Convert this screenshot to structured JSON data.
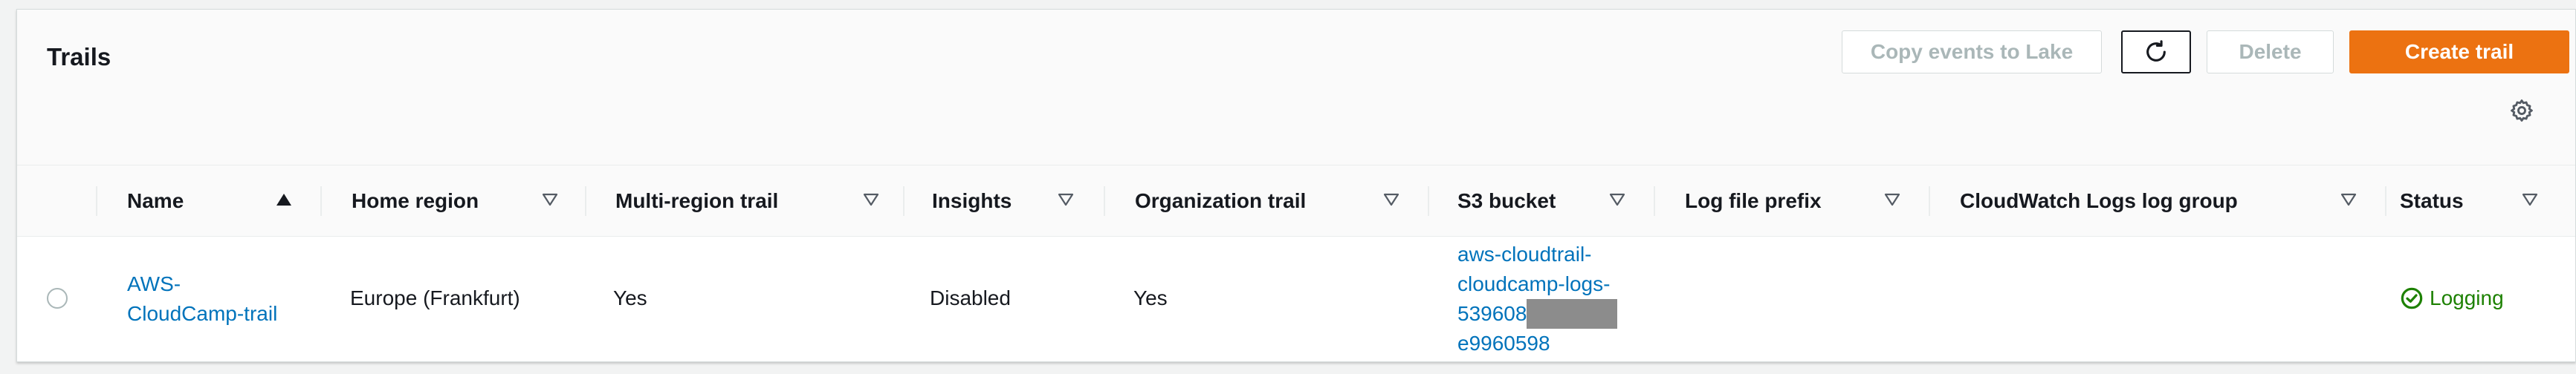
{
  "header": {
    "title": "Trails",
    "buttons": {
      "copy_events": "Copy events to Lake",
      "delete": "Delete",
      "create": "Create trail"
    }
  },
  "table": {
    "columns": [
      {
        "label": "Name",
        "sort": "ascending"
      },
      {
        "label": "Home region",
        "sort": "none"
      },
      {
        "label": "Multi-region trail",
        "sort": "none"
      },
      {
        "label": "Insights",
        "sort": "none"
      },
      {
        "label": "Organization trail",
        "sort": "none"
      },
      {
        "label": "S3 bucket",
        "sort": "none"
      },
      {
        "label": "Log file prefix",
        "sort": "none"
      },
      {
        "label": "CloudWatch Logs log group",
        "sort": "none"
      },
      {
        "label": "Status",
        "sort": "none"
      }
    ],
    "rows": [
      {
        "name": "AWS-CloudCamp-trail",
        "name_lines": [
          "AWS-",
          "CloudCamp-trail"
        ],
        "home_region": "Europe (Frankfurt)",
        "multi_region": "Yes",
        "insights": "Disabled",
        "organization": "Yes",
        "s3_bucket_lines": [
          "aws-cloudtrail-",
          "cloudcamp-logs-",
          "539608",
          "e9960598"
        ],
        "log_file_prefix": "",
        "cloudwatch_log_group": "",
        "status": "Logging"
      }
    ]
  },
  "icons": {
    "refresh": "refresh-icon",
    "settings": "gear-icon",
    "sort_asc": "sort-ascending-icon",
    "sort_none": "sort-icon",
    "status_ok": "check-circle-icon"
  },
  "colors": {
    "primary_button": "#ec7211",
    "link": "#0073bb",
    "status_success": "#1d8102"
  }
}
